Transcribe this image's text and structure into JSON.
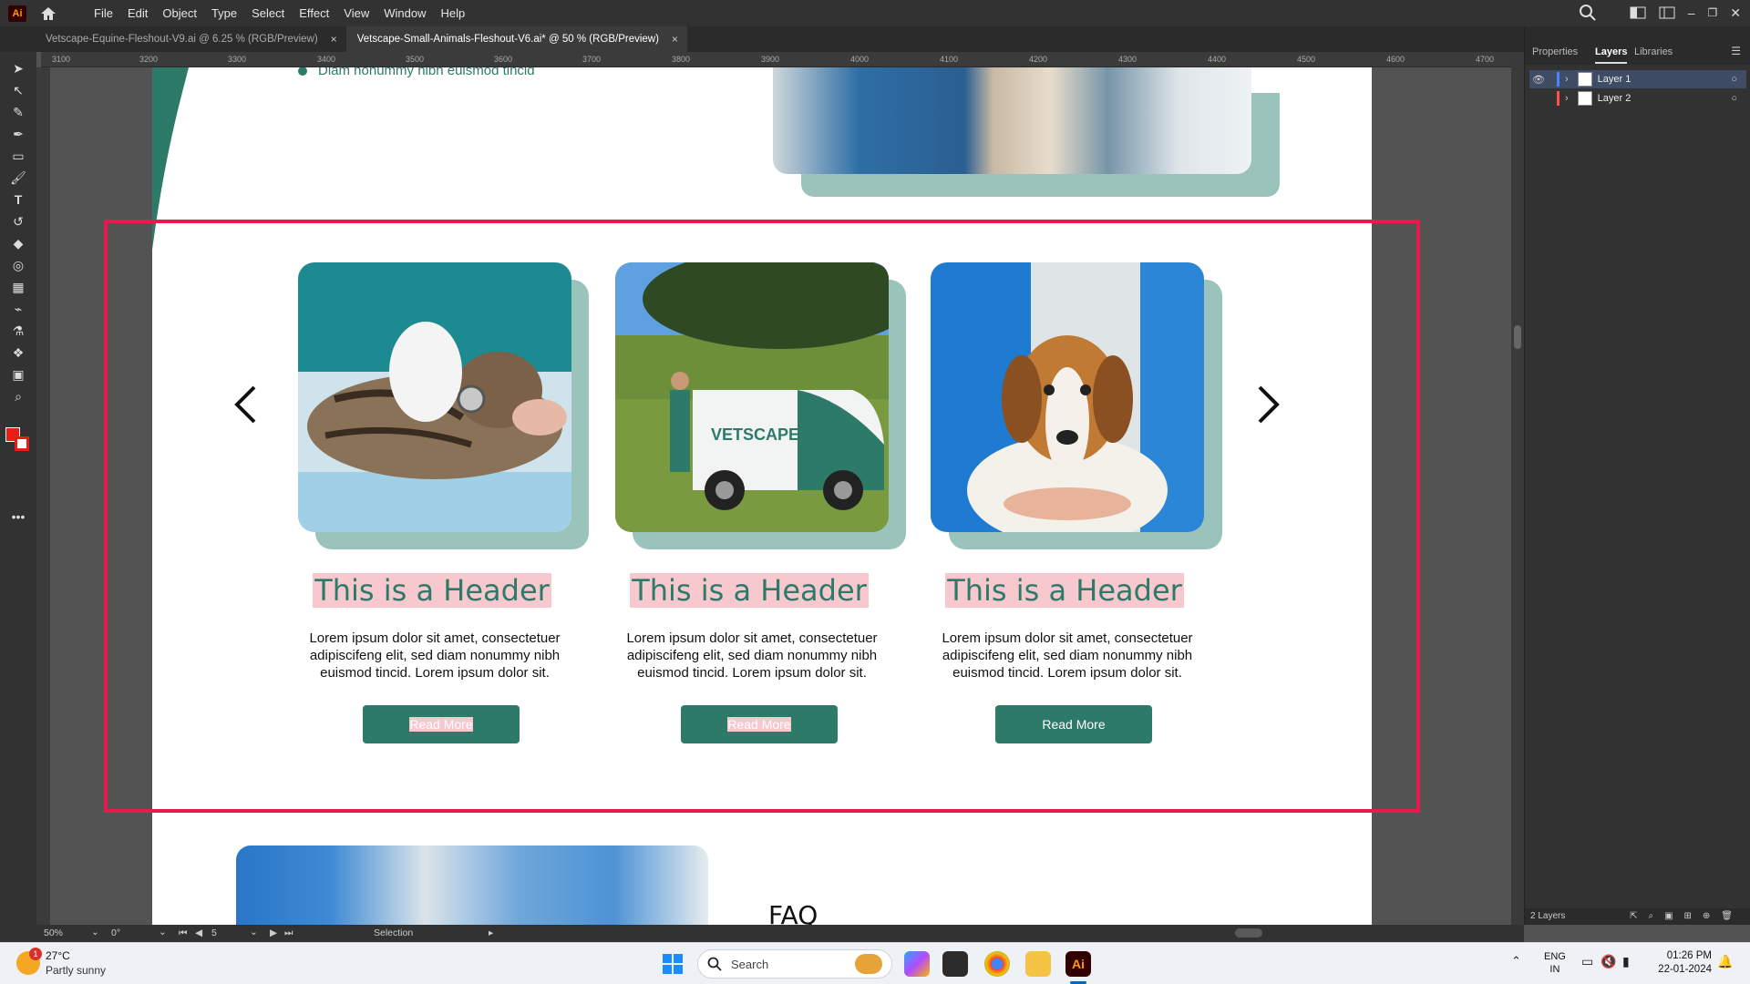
{
  "app": {
    "logo": "Ai"
  },
  "menu": [
    "File",
    "Edit",
    "Object",
    "Type",
    "Select",
    "Effect",
    "View",
    "Window",
    "Help"
  ],
  "tabs": [
    {
      "label": "Vetscape-Equine-Fleshout-V9.ai @ 6.25 % (RGB/Preview)",
      "close": "×"
    },
    {
      "label": "Vetscape-Small-Animals-Fleshout-V6.ai* @ 50 % (RGB/Preview)",
      "close": "×"
    }
  ],
  "ruler_h": [
    "3100",
    "3200",
    "3300",
    "3400",
    "3500",
    "3600",
    "3700",
    "3800",
    "3900",
    "4000",
    "4100",
    "4200",
    "4300",
    "4400",
    "4500",
    "4600",
    "4700"
  ],
  "panel": {
    "tabs": [
      "Properties",
      "Layers",
      "Libraries"
    ],
    "active_tab": "Layers",
    "layers": [
      {
        "name": "Layer 1",
        "color": "#4f81ff"
      },
      {
        "name": "Layer 2",
        "color": "#ff4f4f"
      }
    ],
    "footer": "2 Layers"
  },
  "artboard": {
    "top_bullet": "Diam nonummy nibh euismod tincid",
    "faq_heading": "FAQ",
    "cards": [
      {
        "title": "This is a Header",
        "body": "Lorem ipsum dolor sit amet, consectetuer adipiscifeng elit, sed diam nonummy nibh euismod tincid. Lorem ipsum dolor sit.",
        "button": "Read More",
        "image": "vet examining cat with stethoscope"
      },
      {
        "title": "This is a Header",
        "body": "Lorem ipsum dolor sit amet, consectetuer adipiscifeng elit, sed diam nonummy nibh euismod tincid. Lorem ipsum dolor sit.",
        "button": "Read More",
        "image": "Vetscape van with vet standing"
      },
      {
        "title": "This is a Header",
        "body": "Lorem ipsum dolor sit amet, consectetuer adipiscifeng elit, sed diam nonummy nibh euismod tincid. Lorem ipsum dolor sit.",
        "button": "Read More",
        "image": "vet holding beagle"
      }
    ],
    "van_text": "VETSCAPE",
    "colors": {
      "teal": "#2d7a68",
      "teal_light": "#9ac3bb",
      "highlight": "#f7c9cf",
      "selection": "#e8194c"
    }
  },
  "status": {
    "zoom": "50%",
    "rotation": "0°",
    "artboard": "5",
    "tool": "Selection"
  },
  "taskbar": {
    "weather_temp": "27°C",
    "weather_desc": "Partly sunny",
    "weather_badge": "1",
    "search": "Search",
    "lang1": "ENG",
    "lang2": "IN",
    "time": "01:26 PM",
    "date": "22-01-2024"
  }
}
